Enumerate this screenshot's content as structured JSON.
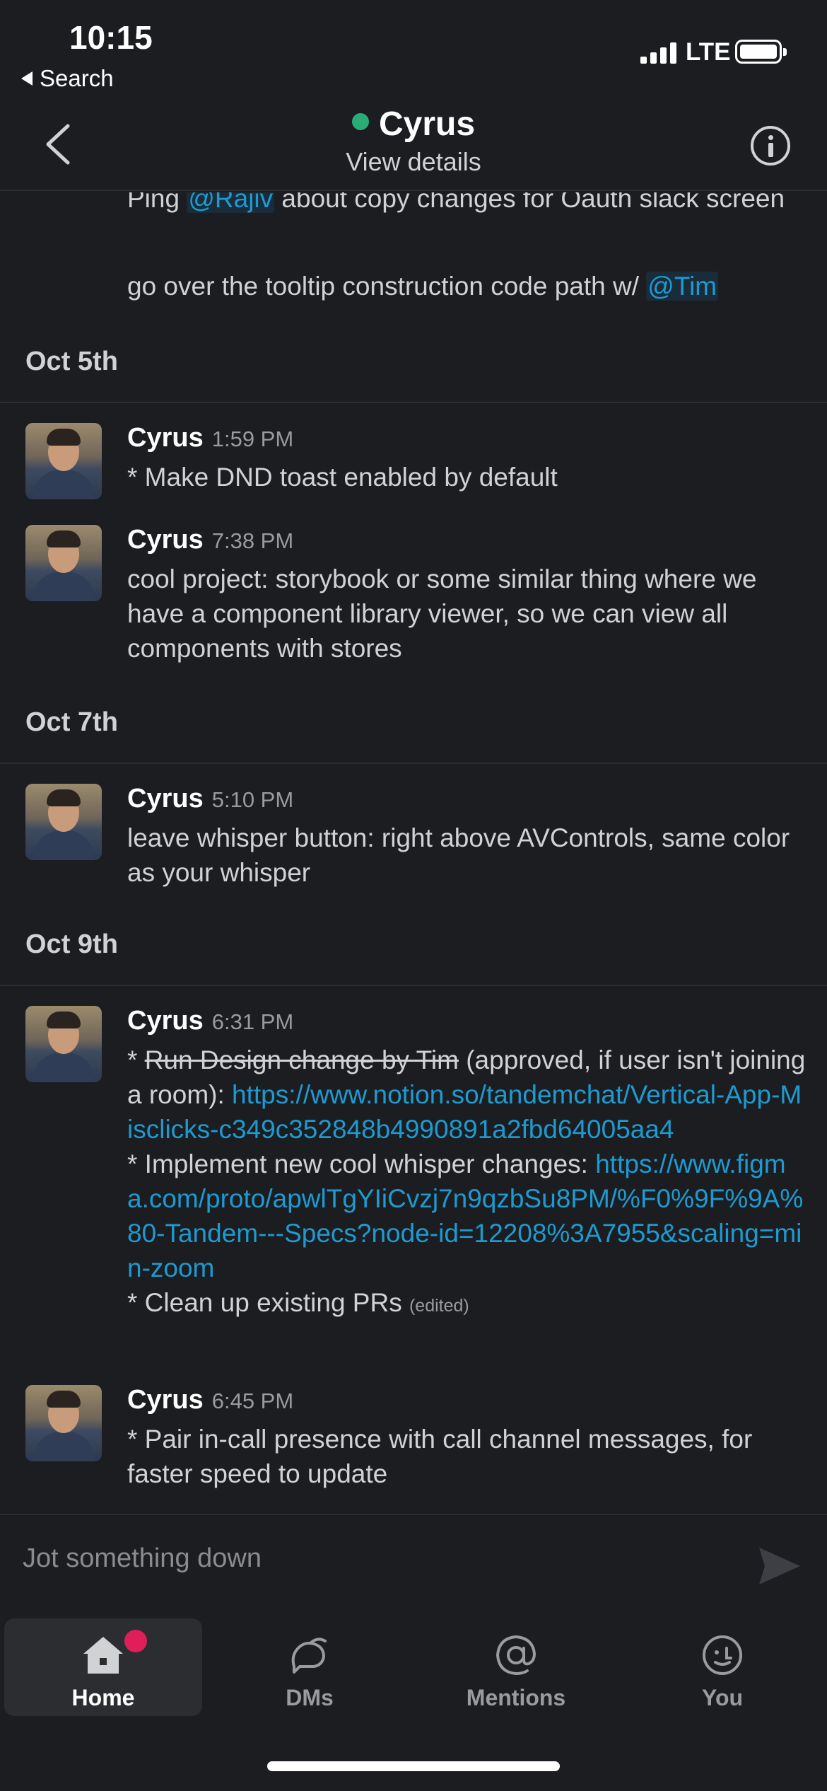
{
  "status_bar": {
    "time": "10:15",
    "back_app": "Search",
    "network": "LTE"
  },
  "header": {
    "title": "Cyrus",
    "subtitle": "View details",
    "presence_color": "#2bac76"
  },
  "continued": {
    "line1_pre": "Ping ",
    "line1_mention": "@Rajiv",
    "line1_post": " about copy changes for Oauth slack screen",
    "line2_pre": "go over the tooltip construction code path w/ ",
    "line2_mention": "@Tim"
  },
  "dates": [
    "Oct 5th",
    "Oct 7th",
    "Oct 9th"
  ],
  "messages": [
    {
      "author": "Cyrus",
      "time": "1:59 PM",
      "text": "* Make DND toast enabled by default"
    },
    {
      "author": "Cyrus",
      "time": "7:38 PM",
      "text": "cool project: storybook or some similar thing where we have a component library viewer, so we can view all components with stores"
    },
    {
      "author": "Cyrus",
      "time": "5:10 PM",
      "text": "leave whisper button: right above AVControls, same color as your whisper"
    },
    {
      "author": "Cyrus",
      "time": "6:31 PM",
      "p1_star": "* ",
      "p1_strike": "Run Design change by Tim",
      "p1_post": " (approved, if user isn't joining a room): ",
      "p1_link": "https://www.notion.so/tandemchat/Vertical-App-Misclicks-c349c352848b4990891a2fbd64005aa4",
      "p2_pre": "* Implement new cool whisper changes: ",
      "p2_link": "https://www.figma.com/proto/apwlTgYIiCvzj7n9qzbSu8PM/%F0%9F%9A%80-Tandem---Specs?node-id=12208%3A7955&scaling=min-zoom",
      "p3": "* Clean up existing PRs",
      "edited": "(edited)"
    },
    {
      "author": "Cyrus",
      "time": "6:45 PM",
      "text": "* Pair in-call presence with call channel messages, for faster speed to update"
    }
  ],
  "composer": {
    "placeholder": "Jot something down"
  },
  "tabs": [
    {
      "label": "Home",
      "icon": "home-icon",
      "active": true
    },
    {
      "label": "DMs",
      "icon": "dms-icon"
    },
    {
      "label": "Mentions",
      "icon": "mentions-icon"
    },
    {
      "label": "You",
      "icon": "you-icon"
    }
  ],
  "colors": {
    "background": "#1b1d21",
    "link": "#1d9bd1",
    "badge": "#e01e5a"
  }
}
